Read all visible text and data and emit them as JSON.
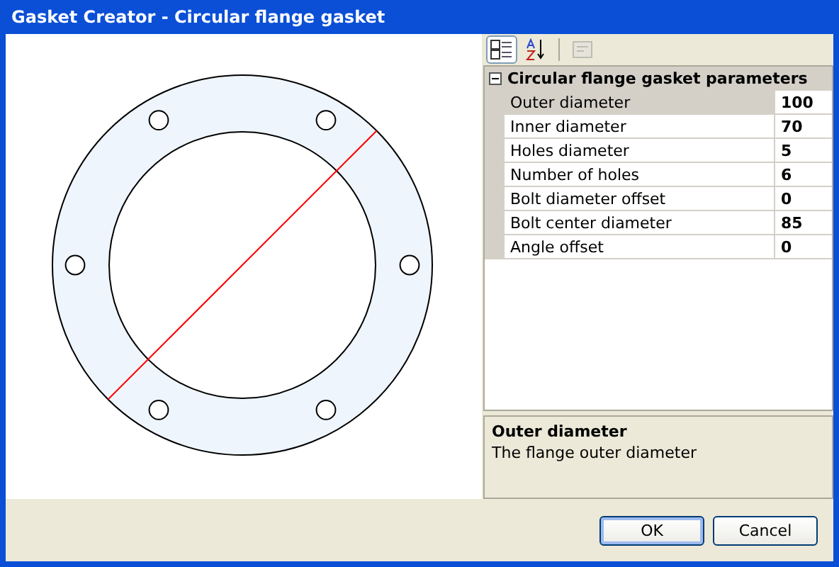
{
  "window": {
    "title": "Gasket Creator - Circular flange gasket"
  },
  "toolbar": [
    {
      "kind": "categorized",
      "selected": true,
      "disabled": false
    },
    {
      "kind": "alphabetical",
      "selected": false,
      "disabled": false
    },
    {
      "kind": "pages",
      "selected": false,
      "disabled": true
    }
  ],
  "property_grid": {
    "category": {
      "label": "Circular flange gasket parameters",
      "expanded": true
    },
    "rows": [
      {
        "name": "Outer diameter",
        "value": "100",
        "selected": true
      },
      {
        "name": "Inner diameter",
        "value": "70",
        "selected": false
      },
      {
        "name": "Holes diameter",
        "value": "5",
        "selected": false
      },
      {
        "name": "Number of holes",
        "value": "6",
        "selected": false
      },
      {
        "name": "Bolt diameter offset",
        "value": "0",
        "selected": false
      },
      {
        "name": "Bolt center diameter",
        "value": "85",
        "selected": false
      },
      {
        "name": "Angle offset",
        "value": "0",
        "selected": false
      }
    ]
  },
  "description": {
    "title": "Outer diameter",
    "text": "The flange outer diameter"
  },
  "buttons": [
    {
      "label": "OK",
      "default": true
    },
    {
      "label": "Cancel",
      "default": false
    }
  ]
}
